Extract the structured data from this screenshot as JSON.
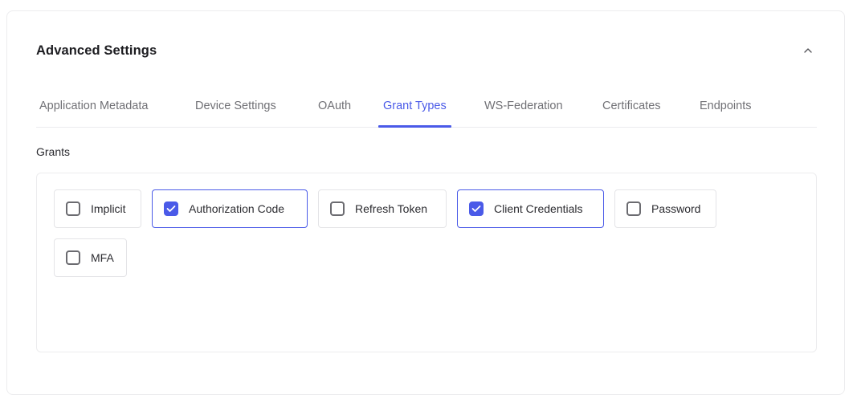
{
  "panel": {
    "title": "Advanced Settings",
    "collapse_icon": "chevron-up-icon"
  },
  "tabs": [
    {
      "label": "Application Metadata",
      "active": false
    },
    {
      "label": "Device Settings",
      "active": false
    },
    {
      "label": "OAuth",
      "active": false
    },
    {
      "label": "Grant Types",
      "active": true
    },
    {
      "label": "WS-Federation",
      "active": false
    },
    {
      "label": "Certificates",
      "active": false
    },
    {
      "label": "Endpoints",
      "active": false
    }
  ],
  "grants": {
    "label": "Grants",
    "options": [
      {
        "label": "Implicit",
        "checked": false
      },
      {
        "label": "Authorization Code",
        "checked": true
      },
      {
        "label": "Refresh Token",
        "checked": false
      },
      {
        "label": "Client Credentials",
        "checked": true
      },
      {
        "label": "Password",
        "checked": false
      },
      {
        "label": "MFA",
        "checked": false
      }
    ]
  },
  "colors": {
    "accent": "#4a5ae8",
    "border": "#ececee",
    "muted_text": "#707075"
  }
}
